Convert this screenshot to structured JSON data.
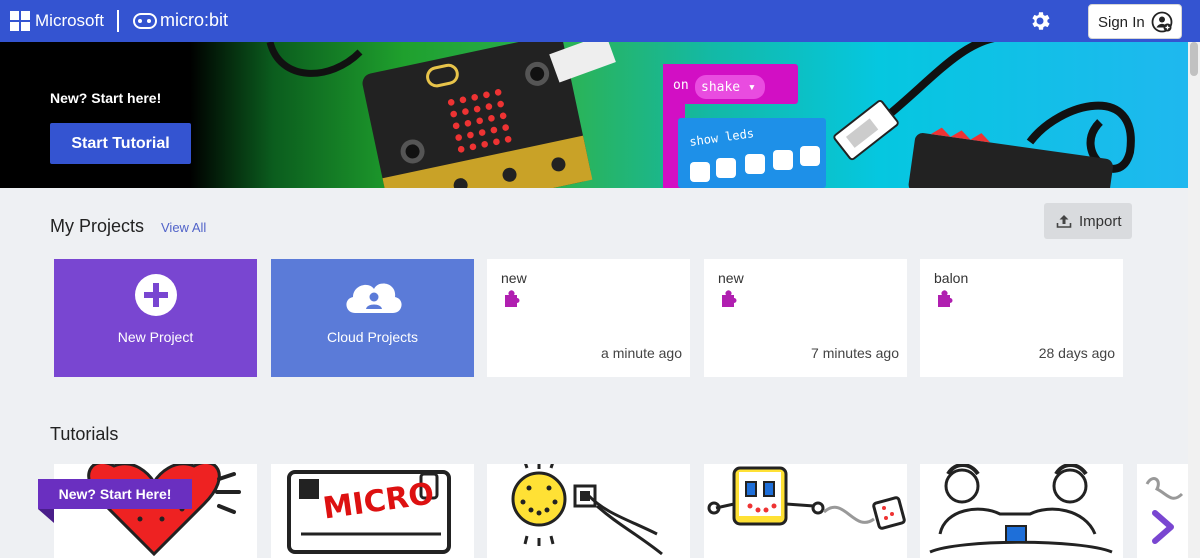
{
  "header": {
    "brand": "Microsoft",
    "product": "micro:bit",
    "settings_icon": "gear-icon",
    "signin_label": "Sign In",
    "signin_icon": "user-circle-icon",
    "accent": "#3454d1"
  },
  "hero": {
    "title": "New? Start here!",
    "button_label": "Start Tutorial",
    "block_event": "on",
    "block_event_value": "shake ▾",
    "block_show": "show leds"
  },
  "projects": {
    "heading": "My Projects",
    "view_all": "View All",
    "import_label": "Import",
    "import_icon": "upload-icon",
    "new_project": {
      "label": "New Project",
      "icon": "plus-circle-icon",
      "color": "#7946d1"
    },
    "cloud_projects": {
      "label": "Cloud Projects",
      "icon": "cloud-user-icon",
      "color": "#5b7bd8"
    },
    "items": [
      {
        "name": "new",
        "time": "a minute ago",
        "icon": "puzzle-icon"
      },
      {
        "name": "new",
        "time": "7 minutes ago",
        "icon": "puzzle-icon"
      },
      {
        "name": "balon",
        "time": "28 days ago",
        "icon": "puzzle-icon"
      }
    ]
  },
  "tutorials": {
    "heading": "Tutorials",
    "ribbon": "New? Start Here!",
    "next_icon": "chevron-right-icon",
    "thumb_text": "MICRO"
  }
}
